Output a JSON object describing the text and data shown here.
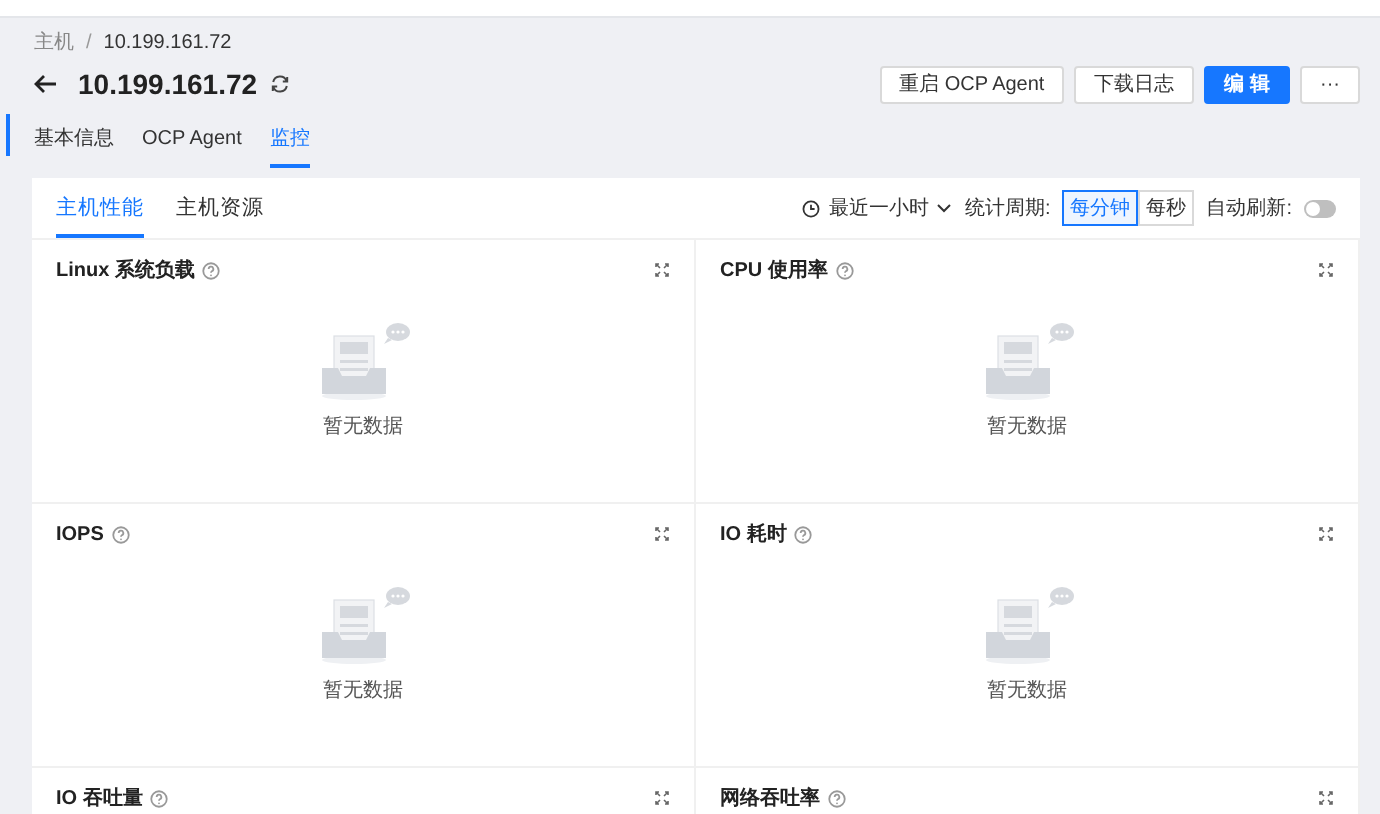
{
  "breadcrumb": [
    {
      "label": "主机",
      "current": false
    },
    {
      "label": "10.199.161.72",
      "current": true
    }
  ],
  "breadcrumb_separator": "/",
  "title": "10.199.161.72",
  "actions": [
    {
      "label": "重启 OCP Agent",
      "kind": "default"
    },
    {
      "label": "下载日志",
      "kind": "default"
    },
    {
      "label": "编 辑",
      "kind": "primary"
    },
    {
      "label": "···",
      "kind": "default"
    }
  ],
  "page_tabs": [
    {
      "label": "基本信息",
      "selected": false
    },
    {
      "label": "OCP Agent",
      "selected": false
    },
    {
      "label": "监控",
      "selected": true
    }
  ],
  "card_tabs": [
    {
      "label": "主机性能",
      "selected": true
    },
    {
      "label": "主机资源",
      "selected": false
    }
  ],
  "time_range": "最近一小时",
  "period": {
    "label": "统计周期:",
    "options": [
      {
        "label": "每分钟",
        "selected": true
      },
      {
        "label": "每秒",
        "selected": false
      }
    ]
  },
  "auto_refresh": {
    "label": "自动刷新:",
    "on": false
  },
  "charts": [
    {
      "title": "Linux 系统负载",
      "empty_text": "暂无数据"
    },
    {
      "title": "CPU 使用率",
      "empty_text": "暂无数据"
    },
    {
      "title": "IOPS",
      "empty_text": "暂无数据"
    },
    {
      "title": "IO 耗时",
      "empty_text": "暂无数据"
    },
    {
      "title": "IO 吞吐量"
    },
    {
      "title": "网络吞吐率"
    }
  ]
}
